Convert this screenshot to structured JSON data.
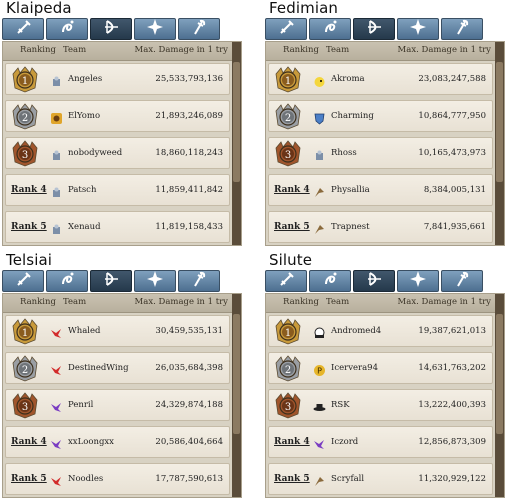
{
  "headers": {
    "ranking": "Ranking",
    "team": "Team",
    "damage": "Max. Damage in 1 try"
  },
  "rank_labels": {
    "r4": "Rank 4",
    "r5": "Rank 5"
  },
  "colors": {
    "gold": "#c89a3b",
    "silver": "#9a9ea3",
    "bronze": "#a0552c",
    "tab": "#5f82a4",
    "tab_active": "#2f4558"
  },
  "tab_icons": [
    "sword-icon",
    "magic-swirl-icon",
    "bow-icon",
    "shuriken-icon",
    "staff-icon"
  ],
  "panels": [
    {
      "title": "Klaipeda",
      "rows": [
        {
          "team": "Angeles",
          "damage": "25,533,793,136",
          "icon": "armor-icon"
        },
        {
          "team": "ElYomo",
          "damage": "21,893,246,089",
          "icon": "gold-face-icon"
        },
        {
          "team": "nobodyweed",
          "damage": "18,860,118,243",
          "icon": "armor-icon"
        },
        {
          "team": "Patsch",
          "damage": "11,859,411,842",
          "icon": "armor-icon"
        },
        {
          "team": "Xenaud",
          "damage": "11,819,158,433",
          "icon": "armor-icon"
        }
      ]
    },
    {
      "title": "Fedimian",
      "rows": [
        {
          "team": "Akroma",
          "damage": "23,083,247,588",
          "icon": "chick-icon"
        },
        {
          "team": "Charming",
          "damage": "10,864,777,950",
          "icon": "shield-icon"
        },
        {
          "team": "Rhoss",
          "damage": "10,165,473,973",
          "icon": "armor-icon"
        },
        {
          "team": "Physallia",
          "damage": "8,384,005,131",
          "icon": "bird-icon"
        },
        {
          "team": "Trapnest",
          "damage": "7,841,935,661",
          "icon": "bird-icon"
        }
      ]
    },
    {
      "title": "Telsiai",
      "rows": [
        {
          "team": "Whaled",
          "damage": "30,459,535,131",
          "icon": "red-dragon-icon"
        },
        {
          "team": "DestinedWing",
          "damage": "26,035,684,398",
          "icon": "red-dragon-icon"
        },
        {
          "team": "Penril",
          "damage": "24,329,874,188",
          "icon": "purple-dragon-icon"
        },
        {
          "team": "xxLoongxx",
          "damage": "20,586,404,664",
          "icon": "purple-dragon-icon"
        },
        {
          "team": "Noodles",
          "damage": "17,787,590,613",
          "icon": "red-dragon-icon"
        }
      ]
    },
    {
      "title": "Silute",
      "rows": [
        {
          "team": "Andromed4",
          "damage": "19,387,621,013",
          "icon": "ghost-icon"
        },
        {
          "team": "Icervera94",
          "damage": "14,631,763,202",
          "icon": "gold-p-icon"
        },
        {
          "team": "RSK",
          "damage": "13,222,400,393",
          "icon": "hat-icon"
        },
        {
          "team": "Iczord",
          "damage": "12,856,873,309",
          "icon": "purple-dragon-icon"
        },
        {
          "team": "Scryfall",
          "damage": "11,320,929,122",
          "icon": "bird-icon"
        }
      ]
    }
  ]
}
